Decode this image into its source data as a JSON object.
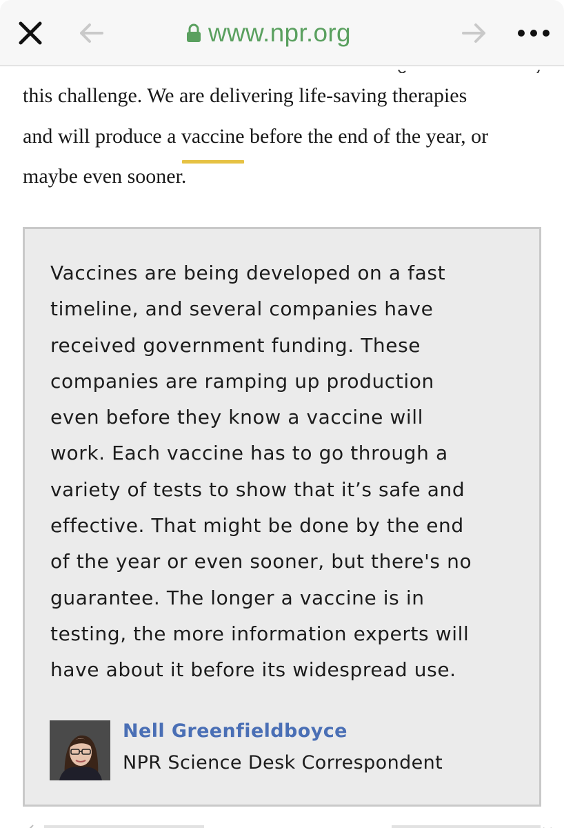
{
  "browser": {
    "url": "www.npr.org",
    "icons": {
      "close": "close-icon",
      "back": "arrow-left-icon",
      "forward": "arrow-right-icon",
      "lock": "lock-icon",
      "more": "more-horizontal-icon"
    },
    "url_color": "#5aa05f"
  },
  "article": {
    "lines": [
      "this challenge.  We are delivering life-saving therapies",
      "and will produce a",
      "vaccine",
      "before the end of the year, or",
      "maybe even sooner."
    ],
    "highlight_color": "#e6c243"
  },
  "annotation": {
    "lines": [
      "Vaccines are being developed on a fast",
      "timeline, and several companies have",
      "received government funding. These",
      "companies are ramping up production",
      "even before they know a vaccine will",
      "work. Each vaccine has to go through a",
      "variety of tests to show that it’s safe and",
      "effective. That might be done by the end",
      "of the year or even sooner, but there's no",
      "guarantee. The longer a vaccine is in",
      "testing, the more information experts will",
      "have about it before its widespread use."
    ],
    "author": {
      "name": "Nell Greenfieldboyce",
      "role": "NPR Science Desk Correspondent",
      "name_color": "#4a6fb5"
    }
  }
}
